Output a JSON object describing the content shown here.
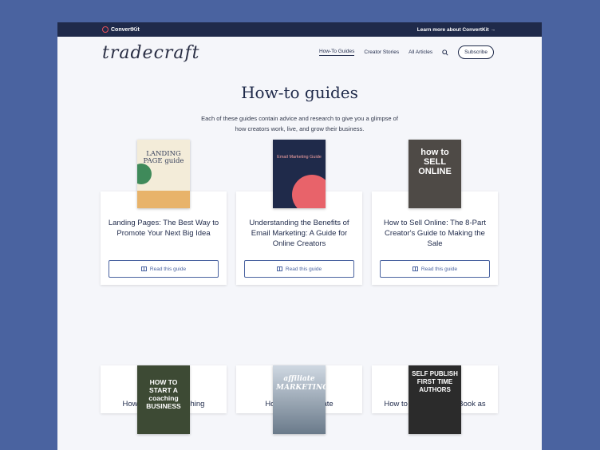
{
  "topbar": {
    "brand": "ConvertKit",
    "learn_more": "Learn more about ConvertKit →"
  },
  "nav": {
    "logo": "tradecraft",
    "links": [
      "How-To Guides",
      "Creator Stories",
      "All Articles"
    ],
    "subscribe": "Subscribe"
  },
  "hero": {
    "title": "How-to guides",
    "description": "Each of these guides contain advice and research to give you a glimpse of how creators work, live, and grow their business."
  },
  "guides": [
    {
      "title": "Landing Pages: The Best Way to Promote Your Next Big Idea",
      "cover_text": "LANDING PAGE guide",
      "button": "Read this guide"
    },
    {
      "title": "Understanding the Benefits of Email Marketing: A Guide for Online Creators",
      "cover_text": "Email Marketing Guide",
      "button": "Read this guide"
    },
    {
      "title": "How to Sell Online: The 8-Part Creator's Guide to Making the Sale",
      "cover_text": "how to SELL ONLINE",
      "button": "Read this guide"
    },
    {
      "title": "How to Start a Coaching",
      "cover_text": "HOW TO START A coaching BUSINESS"
    },
    {
      "title": "How to Start Affiliate",
      "cover_text": "affiliate MARKETING"
    },
    {
      "title": "How to Self Publish a Book as",
      "cover_text": "SELF PUBLISH FIRST TIME AUTHORS"
    }
  ]
}
